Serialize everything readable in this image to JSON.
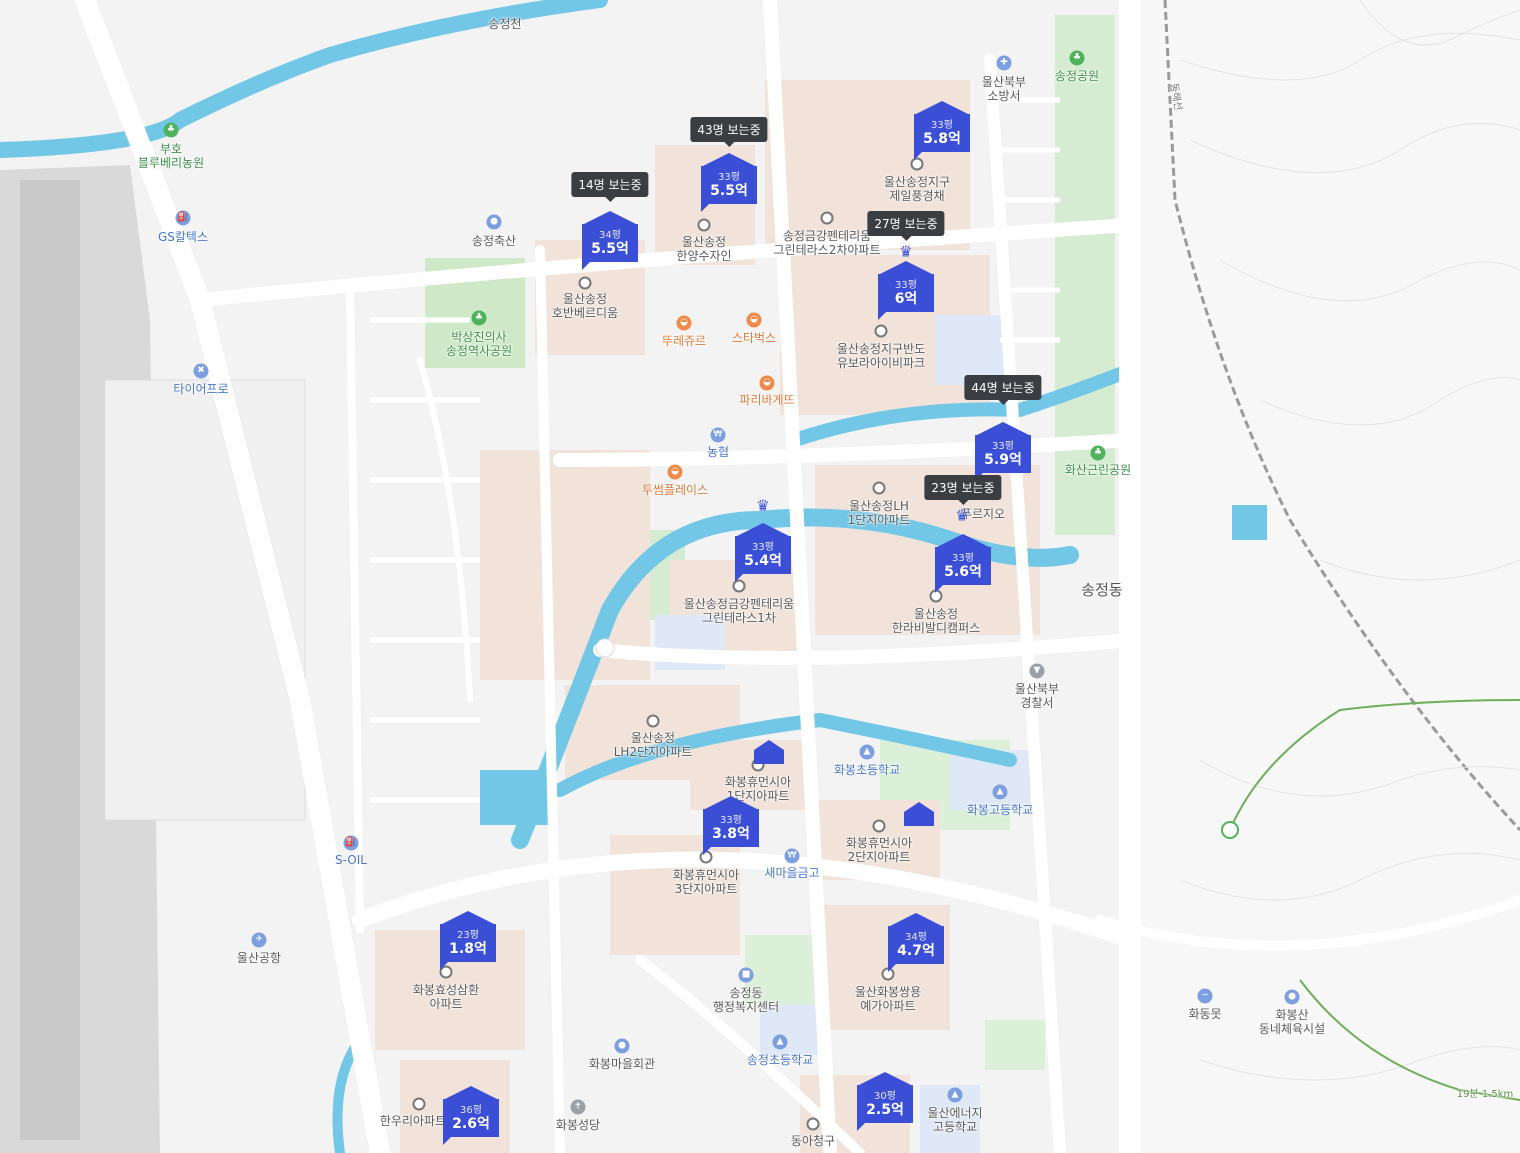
{
  "map": {
    "accent_color": "#3b4fd6",
    "water_color": "#6cc8e8",
    "park_color": "#cfe9c8",
    "apartment_area_color": "#f1e3da"
  },
  "places": {
    "songjeongcheon": "송정천",
    "bugho_line1": "부호",
    "bugho_line2": "블루베리농원",
    "gs_caltex": "GS칼텍스",
    "songjeong_chuksan": "송정축산",
    "bugbu_fire_line1": "울산북부",
    "bugbu_fire_line2": "소방서",
    "songjeong_park": "송정공원",
    "park_memorial_line1": "박상진의사",
    "park_memorial_line2": "송정역사공원",
    "tire_pro": "타이어프로",
    "tous_les_jours": "뚜레쥬르",
    "starbucks": "스타벅스",
    "paris_baguette": "파리바게뜨",
    "nonghyup": "농협",
    "twosome": "투썸플레이스",
    "hwasan_park": "화산근린공원",
    "songjeong_dong": "송정동",
    "police_line1": "울산북부",
    "police_line2": "경찰서",
    "s_oil": "S-OIL",
    "ulsan_airport": "울산공항",
    "hwabong_elem": "화봉초등학교",
    "hwabong_high": "화봉고등학교",
    "saemaul": "새마을금고",
    "admin_center_line1": "송정동",
    "admin_center_line2": "행정복지센터",
    "hwabong_hall": "화봉마을회관",
    "songjeong_elem": "송정초등학교",
    "hwabong_church": "화봉성당",
    "energy_high_line1": "울산에너지",
    "energy_high_line2": "고등학교",
    "hwadong_pond": "화동못",
    "hwabongsan_line1": "화봉산",
    "hwabongsan_line2": "동네체육시설",
    "donghae_line": "동해선",
    "trail": "19분 1.5km"
  },
  "apartments": {
    "a1_l1": "울산송정",
    "a1_l2": "호반베르디움",
    "a2_l1": "울산송정",
    "a2_l2": "한양수자인",
    "a3_l1": "송정금강펜테리움",
    "a3_l2": "그린테라스2차아파트",
    "a4_l1": "울산송정지구",
    "a4_l2": "제일풍경채",
    "a5_l1": "울산송정지구반도",
    "a5_l2": "유보라아이비파크",
    "a6_l1": "울산송정LH",
    "a6_l2": "1단지아파트",
    "a7": "푸르지오",
    "a8_l1": "울산송정금강펜테리움",
    "a8_l2": "그린테라스1차",
    "a9_l1": "울산송정",
    "a9_l2": "한라비발디캠퍼스",
    "a10_l1": "울산송정",
    "a10_l2": "LH2단지아파트",
    "a11_l1": "화봉휴먼시아",
    "a11_l2": "1단지아파트",
    "a12_l1": "화봉휴먼시아",
    "a12_l2": "2단지아파트",
    "a13_l1": "화봉휴먼시아",
    "a13_l2": "3단지아파트",
    "a14_l1": "화봉효성삼환",
    "a14_l2": "아파트",
    "a15_l1": "울산화봉쌍용",
    "a15_l2": "예가아파트",
    "a16": "한우리아파트",
    "a17": "동아청구"
  },
  "markers": [
    {
      "area": "34평",
      "price": "5.5억"
    },
    {
      "area": "33평",
      "price": "5.5억"
    },
    {
      "area": "33평",
      "price": "5.8억"
    },
    {
      "area": "33평",
      "price": "6억"
    },
    {
      "area": "33평",
      "price": "5.9억"
    },
    {
      "area": "33평",
      "price": "5.4억"
    },
    {
      "area": "33평",
      "price": "5.6억"
    },
    {
      "area": "33평",
      "price": "3.8억"
    },
    {
      "area": "23평",
      "price": "1.8억"
    },
    {
      "area": "34평",
      "price": "4.7억"
    },
    {
      "area": "36평",
      "price": "2.6억"
    },
    {
      "area": "30평",
      "price": "2.5억"
    }
  ],
  "viewing": {
    "v1": "14명 보는중",
    "v2": "43명 보는중",
    "v3": "27명 보는중",
    "v4": "44명 보는중",
    "v5": "23명 보는중"
  }
}
